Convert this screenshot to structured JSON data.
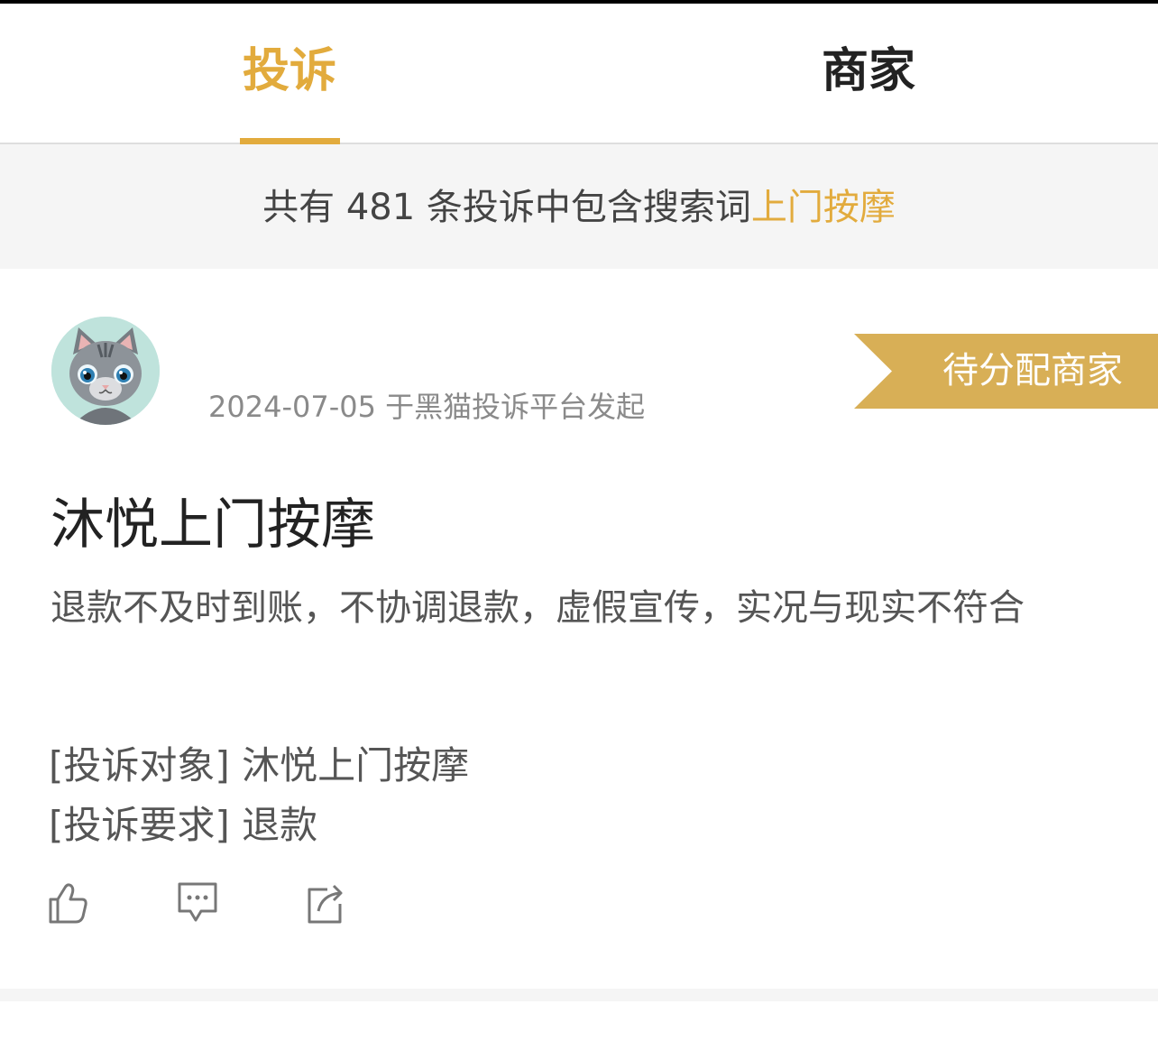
{
  "tabs": [
    {
      "label": "投诉",
      "active": true
    },
    {
      "label": "商家",
      "active": false
    }
  ],
  "search_summary": {
    "prefix": "共有 481 条投诉中包含搜索词",
    "keyword": "上门按摩"
  },
  "complaint": {
    "date": "2024-07-05",
    "platform_text": "于黑猫投诉平台发起",
    "status": "待分配商家",
    "title": "沐悦上门按摩",
    "summary": "退款不及时到账，不协调退款，虚假宣传，实况与现实不符合",
    "target_label": "[投诉对象]",
    "target_value": "沐悦上门按摩",
    "demand_label": "[投诉要求]",
    "demand_value": "退款"
  },
  "icons": {
    "like": "thumbs-up-icon",
    "comment": "comment-icon",
    "share": "share-icon"
  },
  "colors": {
    "accent": "#e2ab3d",
    "status_bg": "#d8af56"
  }
}
